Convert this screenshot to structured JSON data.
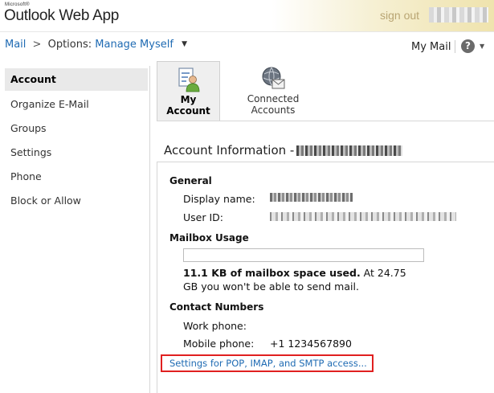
{
  "header": {
    "brand_small": "Microsoft®",
    "brand_name": "Outlook Web App",
    "sign_out": "sign out"
  },
  "breadcrumb": {
    "mail": "Mail",
    "separator": ">",
    "options_label": "Options:",
    "current": "Manage Myself"
  },
  "toolbar": {
    "my_mail": "My Mail",
    "help": "?"
  },
  "sidebar": {
    "items": [
      {
        "label": "Account",
        "selected": true
      },
      {
        "label": "Organize E-Mail"
      },
      {
        "label": "Groups"
      },
      {
        "label": "Settings"
      },
      {
        "label": "Phone"
      },
      {
        "label": "Block or Allow"
      }
    ]
  },
  "tabs": [
    {
      "label": "My Account",
      "icon": "my-account-icon",
      "selected": true
    },
    {
      "label": "Connected Accounts",
      "icon": "connected-accounts-icon"
    }
  ],
  "account": {
    "title": "Account Information -",
    "general": {
      "heading": "General",
      "display_name_label": "Display name:",
      "user_id_label": "User ID:"
    },
    "mailbox": {
      "heading": "Mailbox Usage",
      "usage_fraction": 0.0,
      "used_bold": "11.1 KB of mailbox space used.",
      "used_rest": " At 24.75 GB you won't be able to send mail."
    },
    "contact": {
      "heading": "Contact Numbers",
      "work_label": "Work phone:",
      "work_value": "",
      "mobile_label": "Mobile phone:",
      "mobile_value": "+1 1234567890"
    },
    "pop_link": "Settings for POP, IMAP, and SMTP access..."
  },
  "colors": {
    "link": "#1f6bb3",
    "highlight_box": "#e02020",
    "signout": "#b9a573"
  }
}
